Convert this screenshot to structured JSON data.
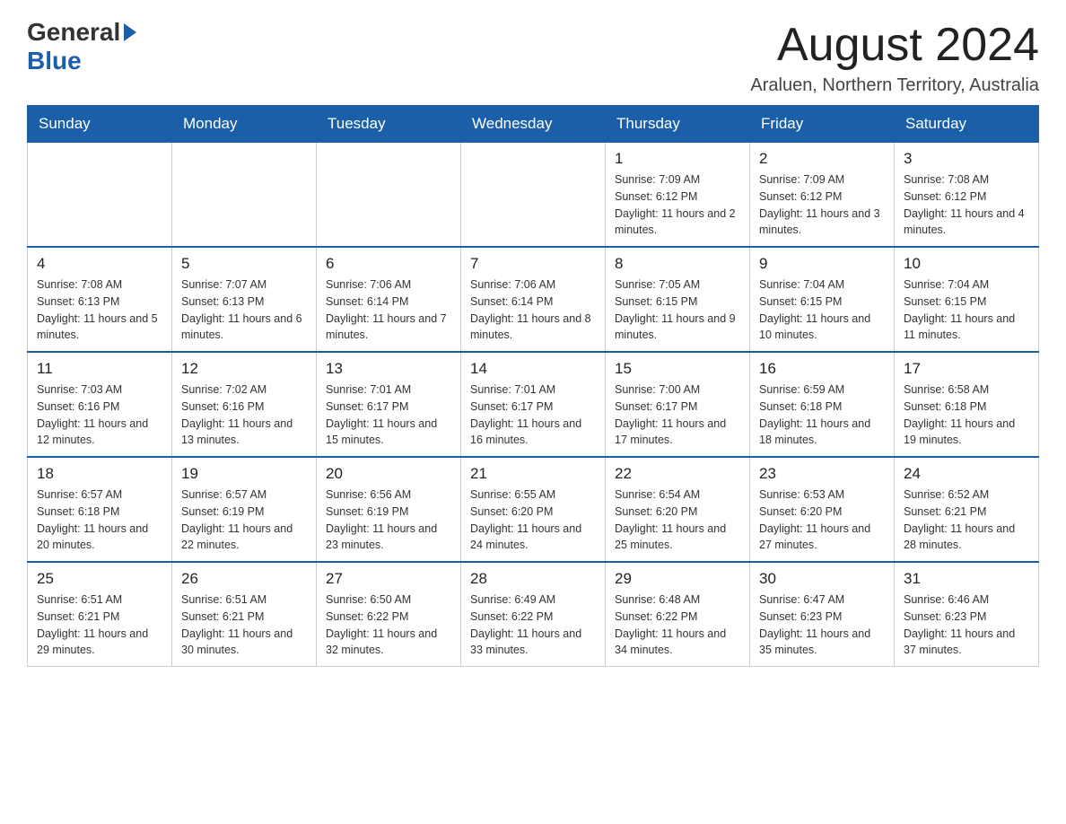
{
  "header": {
    "logo_general": "General",
    "logo_blue": "Blue",
    "title": "August 2024",
    "subtitle": "Araluen, Northern Territory, Australia"
  },
  "days_of_week": [
    "Sunday",
    "Monday",
    "Tuesday",
    "Wednesday",
    "Thursday",
    "Friday",
    "Saturday"
  ],
  "weeks": [
    [
      {
        "day": "",
        "sunrise": "",
        "sunset": "",
        "daylight": ""
      },
      {
        "day": "",
        "sunrise": "",
        "sunset": "",
        "daylight": ""
      },
      {
        "day": "",
        "sunrise": "",
        "sunset": "",
        "daylight": ""
      },
      {
        "day": "",
        "sunrise": "",
        "sunset": "",
        "daylight": ""
      },
      {
        "day": "1",
        "sunrise": "Sunrise: 7:09 AM",
        "sunset": "Sunset: 6:12 PM",
        "daylight": "Daylight: 11 hours and 2 minutes."
      },
      {
        "day": "2",
        "sunrise": "Sunrise: 7:09 AM",
        "sunset": "Sunset: 6:12 PM",
        "daylight": "Daylight: 11 hours and 3 minutes."
      },
      {
        "day": "3",
        "sunrise": "Sunrise: 7:08 AM",
        "sunset": "Sunset: 6:12 PM",
        "daylight": "Daylight: 11 hours and 4 minutes."
      }
    ],
    [
      {
        "day": "4",
        "sunrise": "Sunrise: 7:08 AM",
        "sunset": "Sunset: 6:13 PM",
        "daylight": "Daylight: 11 hours and 5 minutes."
      },
      {
        "day": "5",
        "sunrise": "Sunrise: 7:07 AM",
        "sunset": "Sunset: 6:13 PM",
        "daylight": "Daylight: 11 hours and 6 minutes."
      },
      {
        "day": "6",
        "sunrise": "Sunrise: 7:06 AM",
        "sunset": "Sunset: 6:14 PM",
        "daylight": "Daylight: 11 hours and 7 minutes."
      },
      {
        "day": "7",
        "sunrise": "Sunrise: 7:06 AM",
        "sunset": "Sunset: 6:14 PM",
        "daylight": "Daylight: 11 hours and 8 minutes."
      },
      {
        "day": "8",
        "sunrise": "Sunrise: 7:05 AM",
        "sunset": "Sunset: 6:15 PM",
        "daylight": "Daylight: 11 hours and 9 minutes."
      },
      {
        "day": "9",
        "sunrise": "Sunrise: 7:04 AM",
        "sunset": "Sunset: 6:15 PM",
        "daylight": "Daylight: 11 hours and 10 minutes."
      },
      {
        "day": "10",
        "sunrise": "Sunrise: 7:04 AM",
        "sunset": "Sunset: 6:15 PM",
        "daylight": "Daylight: 11 hours and 11 minutes."
      }
    ],
    [
      {
        "day": "11",
        "sunrise": "Sunrise: 7:03 AM",
        "sunset": "Sunset: 6:16 PM",
        "daylight": "Daylight: 11 hours and 12 minutes."
      },
      {
        "day": "12",
        "sunrise": "Sunrise: 7:02 AM",
        "sunset": "Sunset: 6:16 PM",
        "daylight": "Daylight: 11 hours and 13 minutes."
      },
      {
        "day": "13",
        "sunrise": "Sunrise: 7:01 AM",
        "sunset": "Sunset: 6:17 PM",
        "daylight": "Daylight: 11 hours and 15 minutes."
      },
      {
        "day": "14",
        "sunrise": "Sunrise: 7:01 AM",
        "sunset": "Sunset: 6:17 PM",
        "daylight": "Daylight: 11 hours and 16 minutes."
      },
      {
        "day": "15",
        "sunrise": "Sunrise: 7:00 AM",
        "sunset": "Sunset: 6:17 PM",
        "daylight": "Daylight: 11 hours and 17 minutes."
      },
      {
        "day": "16",
        "sunrise": "Sunrise: 6:59 AM",
        "sunset": "Sunset: 6:18 PM",
        "daylight": "Daylight: 11 hours and 18 minutes."
      },
      {
        "day": "17",
        "sunrise": "Sunrise: 6:58 AM",
        "sunset": "Sunset: 6:18 PM",
        "daylight": "Daylight: 11 hours and 19 minutes."
      }
    ],
    [
      {
        "day": "18",
        "sunrise": "Sunrise: 6:57 AM",
        "sunset": "Sunset: 6:18 PM",
        "daylight": "Daylight: 11 hours and 20 minutes."
      },
      {
        "day": "19",
        "sunrise": "Sunrise: 6:57 AM",
        "sunset": "Sunset: 6:19 PM",
        "daylight": "Daylight: 11 hours and 22 minutes."
      },
      {
        "day": "20",
        "sunrise": "Sunrise: 6:56 AM",
        "sunset": "Sunset: 6:19 PM",
        "daylight": "Daylight: 11 hours and 23 minutes."
      },
      {
        "day": "21",
        "sunrise": "Sunrise: 6:55 AM",
        "sunset": "Sunset: 6:20 PM",
        "daylight": "Daylight: 11 hours and 24 minutes."
      },
      {
        "day": "22",
        "sunrise": "Sunrise: 6:54 AM",
        "sunset": "Sunset: 6:20 PM",
        "daylight": "Daylight: 11 hours and 25 minutes."
      },
      {
        "day": "23",
        "sunrise": "Sunrise: 6:53 AM",
        "sunset": "Sunset: 6:20 PM",
        "daylight": "Daylight: 11 hours and 27 minutes."
      },
      {
        "day": "24",
        "sunrise": "Sunrise: 6:52 AM",
        "sunset": "Sunset: 6:21 PM",
        "daylight": "Daylight: 11 hours and 28 minutes."
      }
    ],
    [
      {
        "day": "25",
        "sunrise": "Sunrise: 6:51 AM",
        "sunset": "Sunset: 6:21 PM",
        "daylight": "Daylight: 11 hours and 29 minutes."
      },
      {
        "day": "26",
        "sunrise": "Sunrise: 6:51 AM",
        "sunset": "Sunset: 6:21 PM",
        "daylight": "Daylight: 11 hours and 30 minutes."
      },
      {
        "day": "27",
        "sunrise": "Sunrise: 6:50 AM",
        "sunset": "Sunset: 6:22 PM",
        "daylight": "Daylight: 11 hours and 32 minutes."
      },
      {
        "day": "28",
        "sunrise": "Sunrise: 6:49 AM",
        "sunset": "Sunset: 6:22 PM",
        "daylight": "Daylight: 11 hours and 33 minutes."
      },
      {
        "day": "29",
        "sunrise": "Sunrise: 6:48 AM",
        "sunset": "Sunset: 6:22 PM",
        "daylight": "Daylight: 11 hours and 34 minutes."
      },
      {
        "day": "30",
        "sunrise": "Sunrise: 6:47 AM",
        "sunset": "Sunset: 6:23 PM",
        "daylight": "Daylight: 11 hours and 35 minutes."
      },
      {
        "day": "31",
        "sunrise": "Sunrise: 6:46 AM",
        "sunset": "Sunset: 6:23 PM",
        "daylight": "Daylight: 11 hours and 37 minutes."
      }
    ]
  ]
}
